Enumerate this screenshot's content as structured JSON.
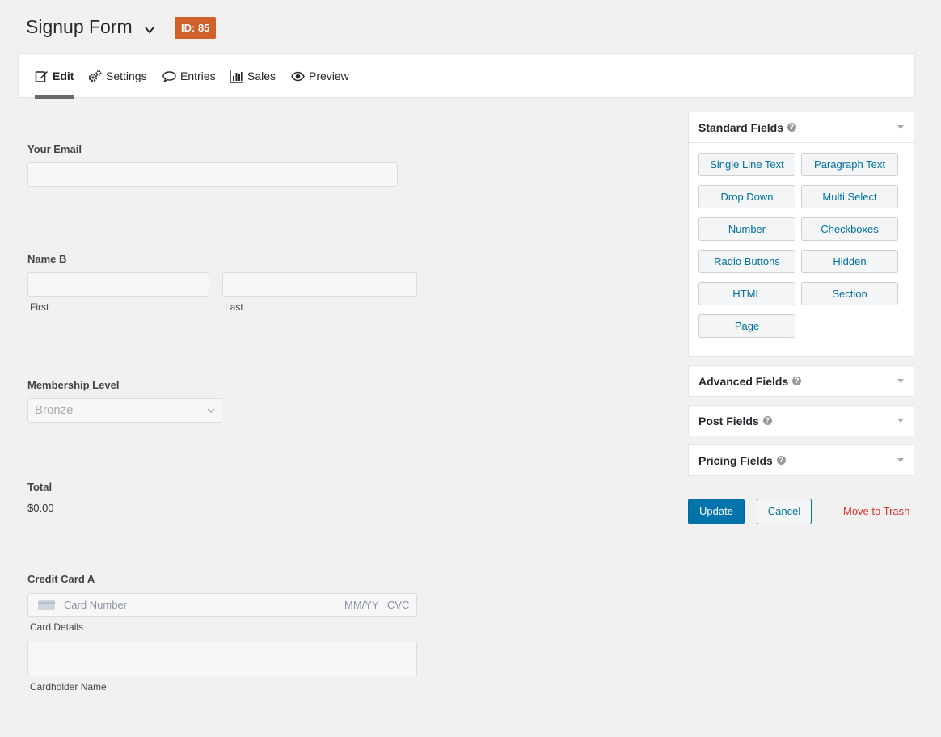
{
  "header": {
    "title": "Signup Form",
    "id_badge": "ID: 85"
  },
  "tabs": [
    {
      "label": "Edit",
      "icon": "edit-icon",
      "active": true
    },
    {
      "label": "Settings",
      "icon": "gears-icon"
    },
    {
      "label": "Entries",
      "icon": "comment-icon"
    },
    {
      "label": "Sales",
      "icon": "bar-chart-icon"
    },
    {
      "label": "Preview",
      "icon": "eye-icon"
    }
  ],
  "form": {
    "email_label": "Your Email",
    "name_label": "Name B",
    "name_first": "First",
    "name_last": "Last",
    "membership_label": "Membership Level",
    "membership_value": "Bronze",
    "total_label": "Total",
    "total_value": "$0.00",
    "cc_label": "Credit Card A",
    "cc_number_placeholder": "Card Number",
    "cc_expiry_placeholder": "MM/YY",
    "cc_cvc_placeholder": "CVC",
    "cc_details": "Card Details",
    "cardholder": "Cardholder Name"
  },
  "sidebar": {
    "standard_title": "Standard Fields",
    "standard_buttons": [
      "Single Line Text",
      "Paragraph Text",
      "Drop Down",
      "Multi Select",
      "Number",
      "Checkboxes",
      "Radio Buttons",
      "Hidden",
      "HTML",
      "Section",
      "Page"
    ],
    "advanced_title": "Advanced Fields",
    "post_title": "Post Fields",
    "pricing_title": "Pricing Fields",
    "update": "Update",
    "cancel": "Cancel",
    "trash": "Move to Trash"
  },
  "colors": {
    "badge": "#d1612a",
    "primary": "#0073aa",
    "link": "#0071a1",
    "danger": "#dc3232"
  }
}
